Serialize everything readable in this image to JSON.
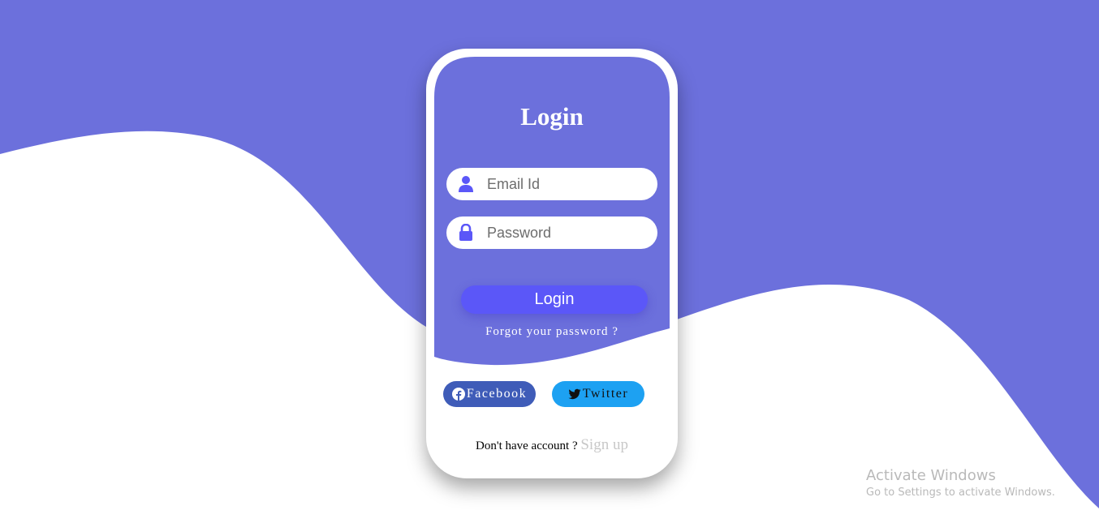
{
  "colors": {
    "primary": "#6c70dc",
    "button": "#5b57f8",
    "facebook": "#3f5cb8",
    "twitter": "#1da1f2",
    "background": "#ffffff"
  },
  "login_form": {
    "title": "Login",
    "email_field": {
      "icon": "user-icon",
      "placeholder": "Email Id",
      "value": ""
    },
    "password_field": {
      "icon": "lock-icon",
      "placeholder": "Password",
      "value": ""
    },
    "login_button": "Login",
    "forgot_password": "Forgot your password ?",
    "social": {
      "facebook": {
        "icon": "facebook-icon",
        "label": "Facebook"
      },
      "twitter": {
        "icon": "twitter-icon",
        "label": "Twitter"
      }
    },
    "signup_prompt": "Don't have account ?",
    "signup_link": "Sign up"
  },
  "os_overlay": {
    "line1": "Activate Windows",
    "line2": "Go to Settings to activate Windows."
  }
}
